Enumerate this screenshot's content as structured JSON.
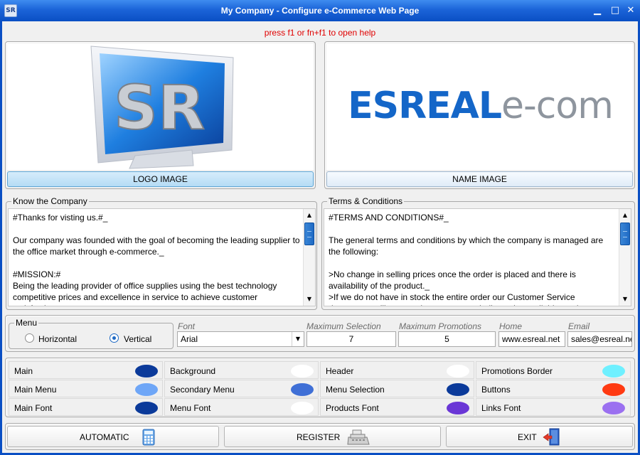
{
  "window": {
    "title": "My Company - Configure e-Commerce Web Page",
    "icon": "sr-app-icon",
    "min": "minimize-icon",
    "max": "maximize-icon",
    "close": "close-icon"
  },
  "help_text": "press f1 or fn+f1 to open help",
  "logo_panel": {
    "button_label": "LOGO IMAGE",
    "logo_text": "SR"
  },
  "name_panel": {
    "button_label": "NAME IMAGE",
    "name_text_a": "ESREAL",
    "name_text_b": "e-com"
  },
  "know_company": {
    "label": "Know the Company",
    "text": "#Thanks for visting us.#_\n\nOur company was founded with the goal of becoming the leading supplier to the office market through e-commerce._\n\n#MISSION:#\nBeing the leading provider of office supplies using the best technology competitive prices and excellence in service to achieve customer satisfaction._"
  },
  "terms": {
    "label": "Terms & Conditions",
    "text": "#TERMS AND CONDITIONS#_\n\nThe general terms and conditions by which the company is managed are the following:\n\n>No change in selling prices once the order is placed and there is availability of the product._\n>If we do not have in stock the entire order our Customer Service department will contact the customer to indicate the available products._"
  },
  "menu": {
    "label": "Menu",
    "horizontal": "Horizontal",
    "vertical": "Vertical",
    "selected": "Vertical"
  },
  "font": {
    "label": "Font",
    "value": "Arial"
  },
  "max_selection": {
    "label": "Maximum Selection",
    "value": "7"
  },
  "max_promotions": {
    "label": "Maximum Promotions",
    "value": "5"
  },
  "home": {
    "label": "Home",
    "value": "www.esreal.net"
  },
  "email": {
    "label": "Email",
    "value": "sales@esreal.net"
  },
  "colors": [
    {
      "label": "Main",
      "color": "#0b3a9a"
    },
    {
      "label": "Background",
      "color": "#ffffff"
    },
    {
      "label": "Header",
      "color": "#ffffff"
    },
    {
      "label": "Promotions Border",
      "color": "#6ff0ff"
    },
    {
      "label": "Main Menu",
      "color": "#6ea6f7"
    },
    {
      "label": "Secondary Menu",
      "color": "#3f6fd6"
    },
    {
      "label": "Menu Selection",
      "color": "#0b3a9a"
    },
    {
      "label": "Buttons",
      "color": "#ff3a12"
    },
    {
      "label": "Main Font",
      "color": "#0b3a9a"
    },
    {
      "label": "Menu Font",
      "color": "#ffffff"
    },
    {
      "label": "Products Font",
      "color": "#6a36d6"
    },
    {
      "label": "Links Font",
      "color": "#9b70f0"
    }
  ],
  "buttons": {
    "automatic": "AUTOMATIC",
    "register": "REGISTER",
    "exit": "EXIT"
  },
  "accent": "#0a4fc4"
}
